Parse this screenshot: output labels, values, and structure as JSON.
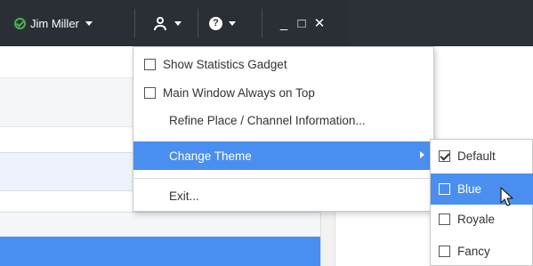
{
  "titlebar": {
    "user_name": "Jim Miller",
    "status_icon": "check-circle-icon",
    "agent_icon": "agent-icon",
    "help_icon": "help-icon",
    "help_glyph": "?",
    "minimize_glyph": "_",
    "maximize_glyph": "□",
    "close_glyph": "✕"
  },
  "menu": {
    "items": [
      {
        "label": "Show Statistics Gadget",
        "type": "checkbox",
        "checked": false
      },
      {
        "label": "Main Window Always on Top",
        "type": "checkbox",
        "checked": false
      },
      {
        "label": "Refine Place / Channel Information...",
        "type": "plain"
      },
      {
        "label": "Change Theme",
        "type": "submenu",
        "active": true
      },
      {
        "label": "Exit...",
        "type": "plain"
      }
    ]
  },
  "theme_submenu": {
    "items": [
      {
        "label": "Default",
        "checked": true
      },
      {
        "label": "Blue",
        "checked": false,
        "hovered": true
      },
      {
        "label": "Royale",
        "checked": false
      },
      {
        "label": "Fancy",
        "checked": false
      }
    ]
  },
  "colors": {
    "titlebar_bg": "#2c3138",
    "accent_blue": "#4a8ff0",
    "status_green": "#4caf50"
  }
}
